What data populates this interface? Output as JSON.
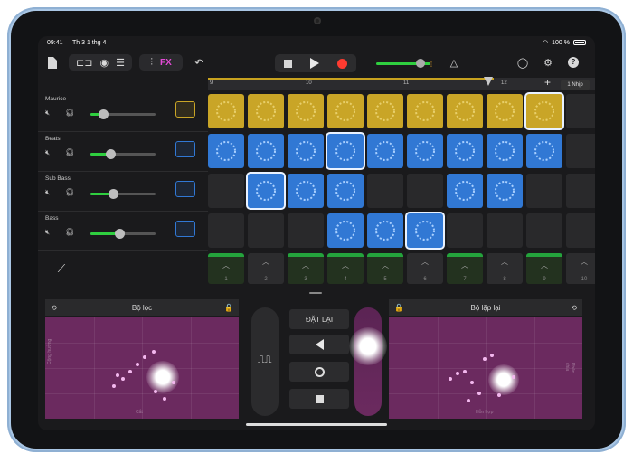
{
  "status": {
    "time": "09:41",
    "date": "Th 3 1 thg 4",
    "battery": "100 %"
  },
  "toolbar": {
    "fx_label": "FX"
  },
  "ruler": {
    "marks": [
      "9",
      "10",
      "11",
      "12"
    ],
    "bar_label": "1 Nhịp"
  },
  "tracks": [
    {
      "name": "Maurice",
      "volume": 0.2,
      "color": "#c9a527"
    },
    {
      "name": "Beats",
      "volume": 0.3,
      "color": "#3178d4"
    },
    {
      "name": "Sub Bass",
      "volume": 0.35,
      "color": "#3178d4"
    },
    {
      "name": "Bass",
      "volume": 0.45,
      "color": "#3178d4"
    }
  ],
  "grid": {
    "rows": [
      [
        "y",
        "y",
        "y",
        "y",
        "y",
        "y",
        "y",
        "y",
        "y-sel",
        "e"
      ],
      [
        "b",
        "b",
        "b",
        "b-sel",
        "b",
        "b",
        "b",
        "b",
        "b",
        "e"
      ],
      [
        "e",
        "b-sel",
        "b",
        "b",
        "e",
        "e",
        "b",
        "b",
        "e",
        "e"
      ],
      [
        "e",
        "e",
        "e",
        "b",
        "b",
        "b-sel",
        "e",
        "e",
        "e",
        "e"
      ]
    ]
  },
  "triggers": [
    "1",
    "2",
    "3",
    "4",
    "5",
    "6",
    "7",
    "8",
    "9",
    "10"
  ],
  "left_panel": {
    "title": "Bộ lọc",
    "y_axis": "Cộng hưởng",
    "x_axis": "Cắt"
  },
  "right_panel": {
    "title": "Bộ lặp lại",
    "y_axis": "Phân chia",
    "x_axis": "Hỗn hợp"
  },
  "center": {
    "reset_label": "ĐẶT LẠI"
  }
}
